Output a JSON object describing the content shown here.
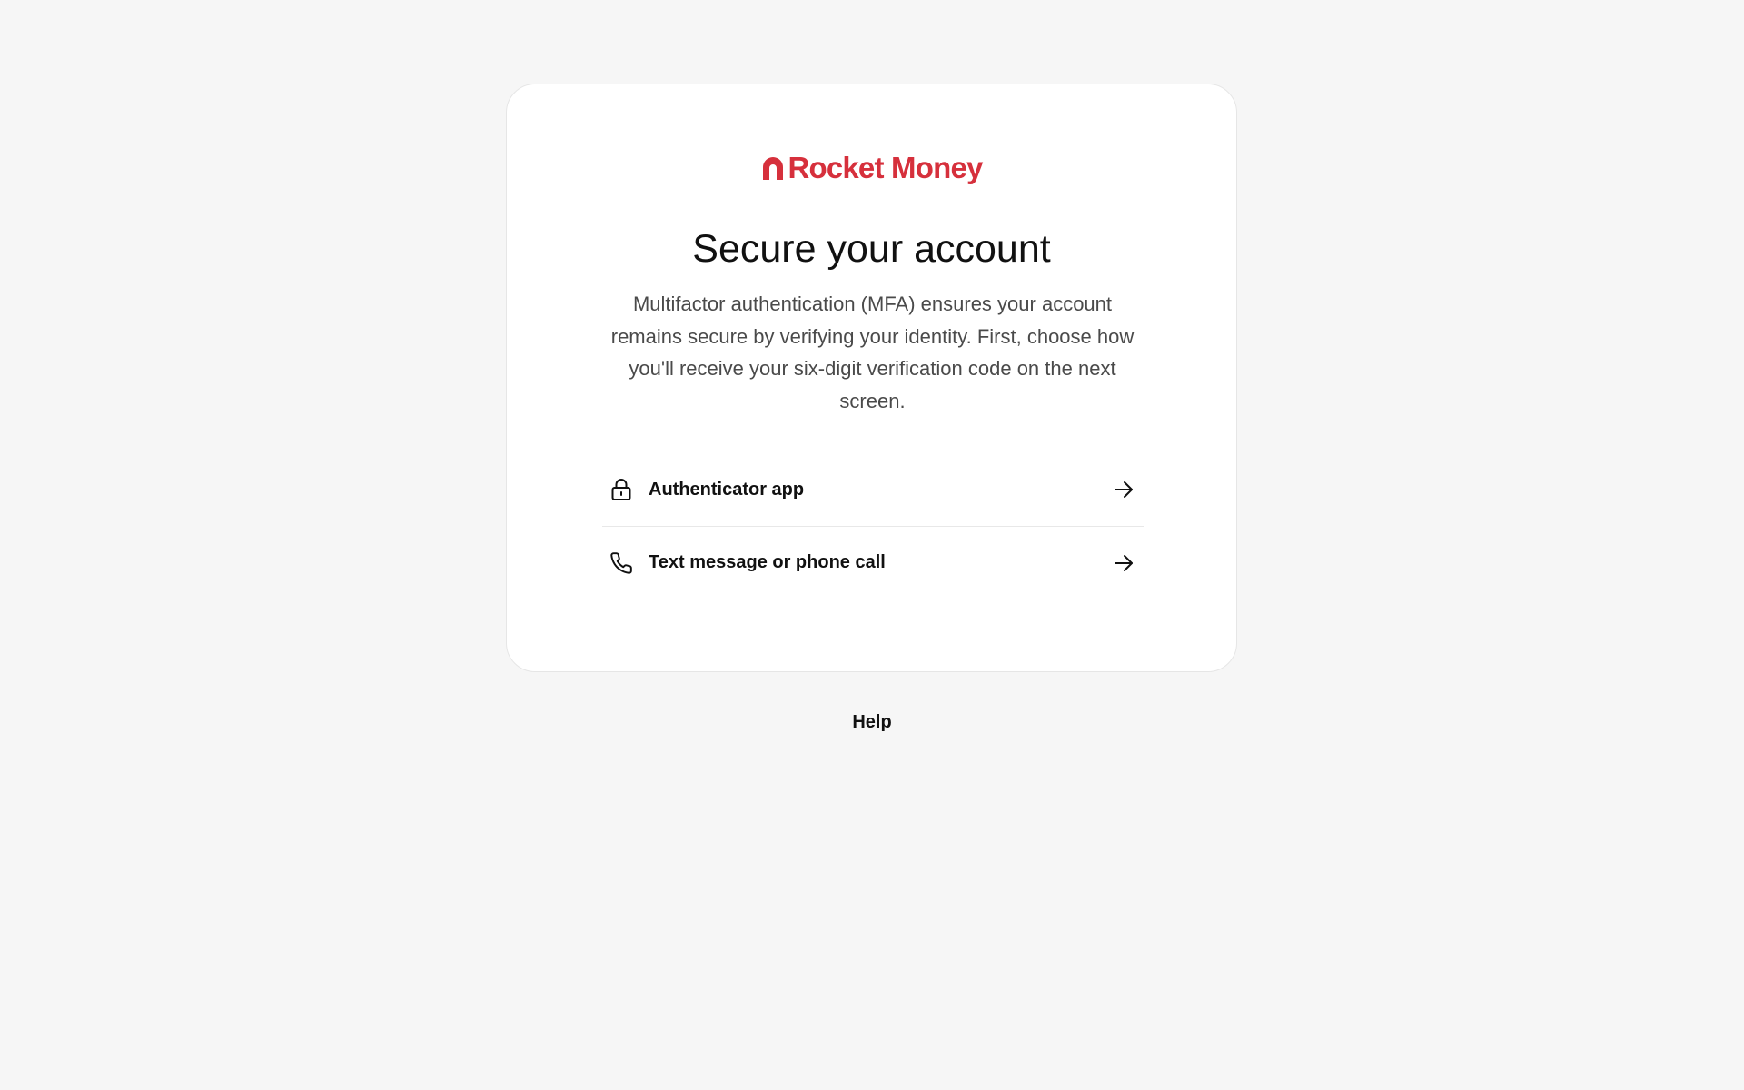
{
  "brand": {
    "name": "Rocket Money",
    "color": "#d6303c"
  },
  "page": {
    "title": "Secure your account",
    "description": "Multifactor authentication (MFA) ensures your account remains secure by verifying your identity. First, choose how you'll receive your six-digit verification code on the next screen."
  },
  "options": [
    {
      "label": "Authenticator app",
      "icon": "lock-icon",
      "action_icon": "arrow-right-icon"
    },
    {
      "label": "Text message or phone call",
      "icon": "phone-icon",
      "action_icon": "arrow-right-icon"
    }
  ],
  "footer": {
    "help_label": "Help"
  },
  "colors": {
    "background": "#f6f6f6",
    "card": "#ffffff",
    "text": "#111111",
    "muted_text": "#4a4a4a",
    "divider": "#e8e8e8"
  }
}
